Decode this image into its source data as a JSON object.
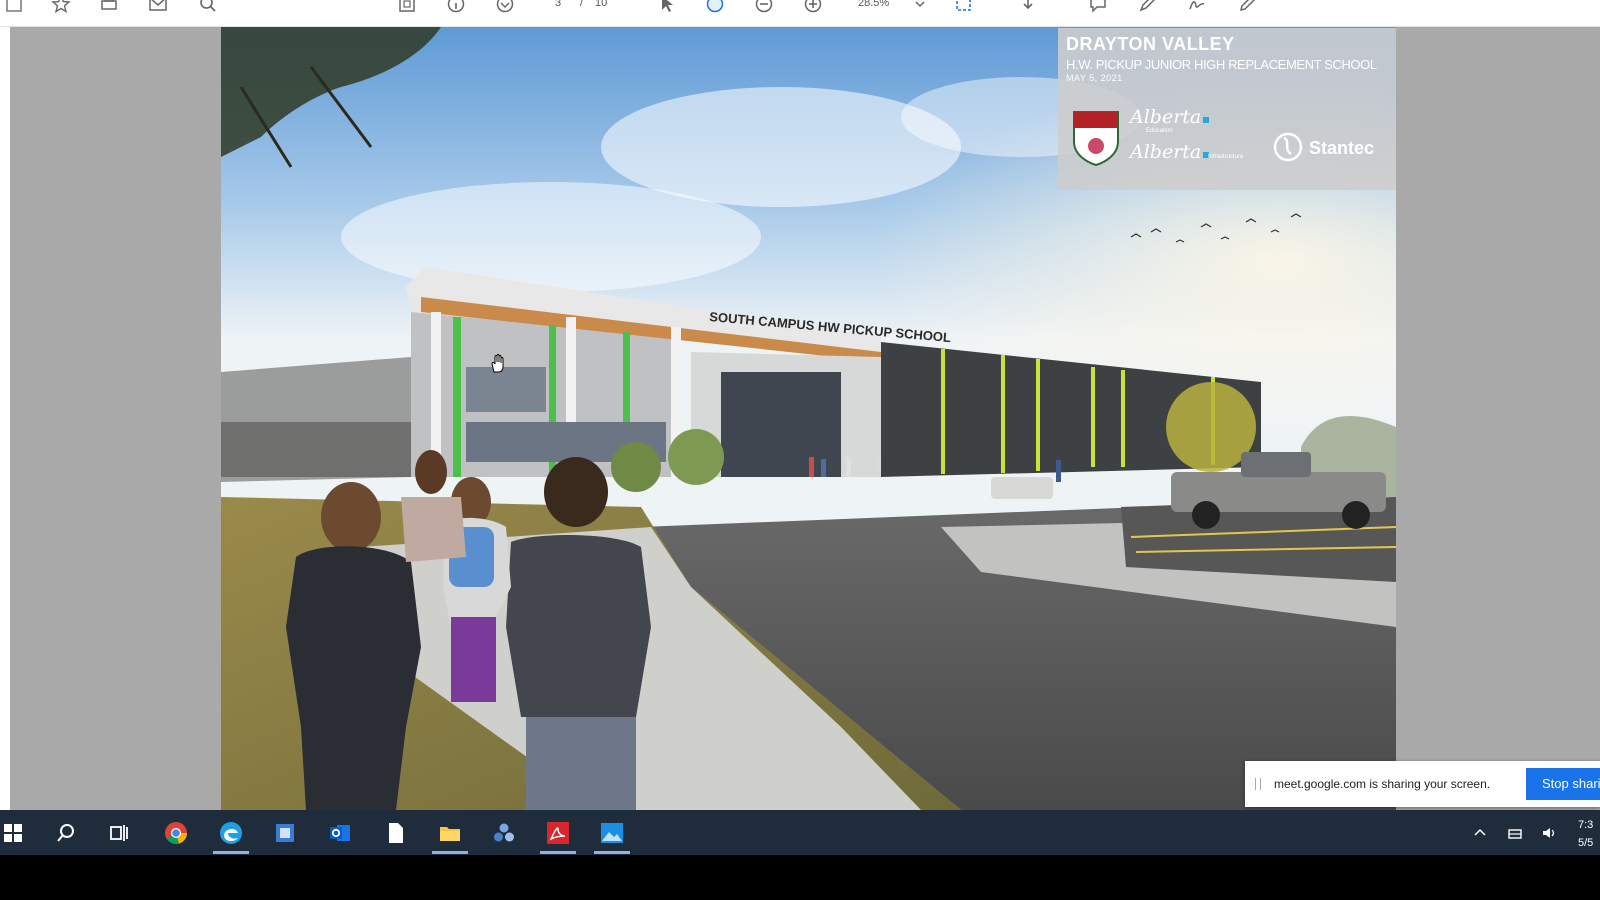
{
  "toolbar": {
    "page_current": "3",
    "page_separator": "/",
    "page_total": "10",
    "zoom": "28.5%",
    "icons": [
      "save-icon",
      "bookmark-star-icon",
      "print-icon",
      "email-icon",
      "search-zoom-icon",
      "fit-page-icon",
      "info-icon",
      "scroll-down-icon",
      "select-cursor-icon",
      "hand-tool-icon",
      "zoom-out-icon",
      "zoom-in-icon",
      "zoom-dropdown-icon",
      "marquee-icon",
      "download-icon",
      "comment-icon",
      "highlight-pen-icon",
      "sign-icon",
      "edit-pencil-icon"
    ]
  },
  "document": {
    "title": "DRAYTON VALLEY",
    "subtitle": "H.W. PICKUP JUNIOR HIGH REPLACEMENT SCHOOL",
    "date": "MAY 5, 2021",
    "building_sign": "SOUTH CAMPUS HW PICKUP SCHOOL",
    "logos": {
      "crest_text": "WILD ROSE",
      "alberta_1": "Alberta",
      "alberta_1_sub": "Education",
      "alberta_2": "Alberta",
      "alberta_2_sub": "Infrastructure",
      "stantec": "Stantec"
    },
    "colors": {
      "sky": "#9cc3e8",
      "building_wood": "#c98a4c",
      "accent_green": "#4cc04a",
      "alberta_blue": "#27a6df"
    }
  },
  "share_bar": {
    "message": "meet.google.com is sharing your screen.",
    "button": "Stop sharing"
  },
  "taskbar": {
    "apps": [
      "windows-start-icon",
      "search-icon",
      "task-view-icon",
      "chrome-icon",
      "edge-icon",
      "app-icon",
      "outlook-icon",
      "file-icon",
      "file-explorer-icon",
      "cluster-app-icon",
      "acrobat-icon",
      "photos-icon"
    ],
    "clock_time": "7:3",
    "clock_date": "5/5"
  }
}
